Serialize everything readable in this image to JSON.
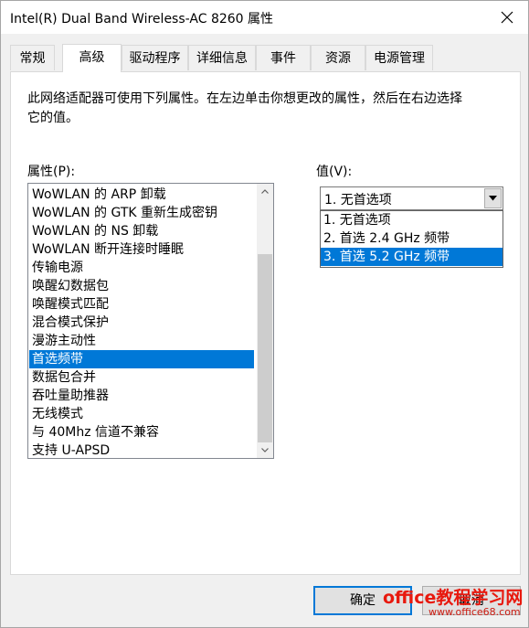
{
  "window": {
    "title": "Intel(R) Dual Band Wireless-AC 8260 属性",
    "close_icon": "close-icon"
  },
  "tabs": [
    {
      "label": "常规",
      "active": false
    },
    {
      "label": "高级",
      "active": true
    },
    {
      "label": "驱动程序",
      "active": false
    },
    {
      "label": "详细信息",
      "active": false
    },
    {
      "label": "事件",
      "active": false
    },
    {
      "label": "资源",
      "active": false
    },
    {
      "label": "电源管理",
      "active": false
    }
  ],
  "advanced": {
    "description": "此网络适配器可使用下列属性。在左边单击你想更改的属性，然后在右边选择它的值。",
    "property_label": "属性(P):",
    "value_label": "值(V):",
    "properties": [
      {
        "label": "WoWLAN 的 ARP 卸载",
        "selected": false
      },
      {
        "label": "WoWLAN 的 GTK 重新生成密钥",
        "selected": false
      },
      {
        "label": "WoWLAN 的 NS 卸载",
        "selected": false
      },
      {
        "label": "WoWLAN 断开连接时睡眠",
        "selected": false
      },
      {
        "label": "传输电源",
        "selected": false
      },
      {
        "label": "唤醒幻数据包",
        "selected": false
      },
      {
        "label": "唤醒模式匹配",
        "selected": false
      },
      {
        "label": "混合模式保护",
        "selected": false
      },
      {
        "label": "漫游主动性",
        "selected": false
      },
      {
        "label": "首选频带",
        "selected": true
      },
      {
        "label": "数据包合并",
        "selected": false
      },
      {
        "label": "吞吐量助推器",
        "selected": false
      },
      {
        "label": "无线模式",
        "selected": false
      },
      {
        "label": "与 40Mhz 信道不兼容",
        "selected": false
      },
      {
        "label": "支持 U-APSD",
        "selected": false
      }
    ],
    "value_current": "1. 无首选项",
    "value_options": [
      {
        "label": "1. 无首选项",
        "highlighted": false
      },
      {
        "label": "2. 首选 2.4 GHz 频带",
        "highlighted": false
      },
      {
        "label": "3. 首选 5.2 GHz 频带",
        "highlighted": true
      }
    ]
  },
  "buttons": {
    "ok": "确定",
    "cancel": "取消"
  },
  "watermark": {
    "title": "office教程学习网",
    "url": "www.office68.com"
  },
  "colors": {
    "selection": "#0078d7",
    "watermark": "#e8190e"
  }
}
